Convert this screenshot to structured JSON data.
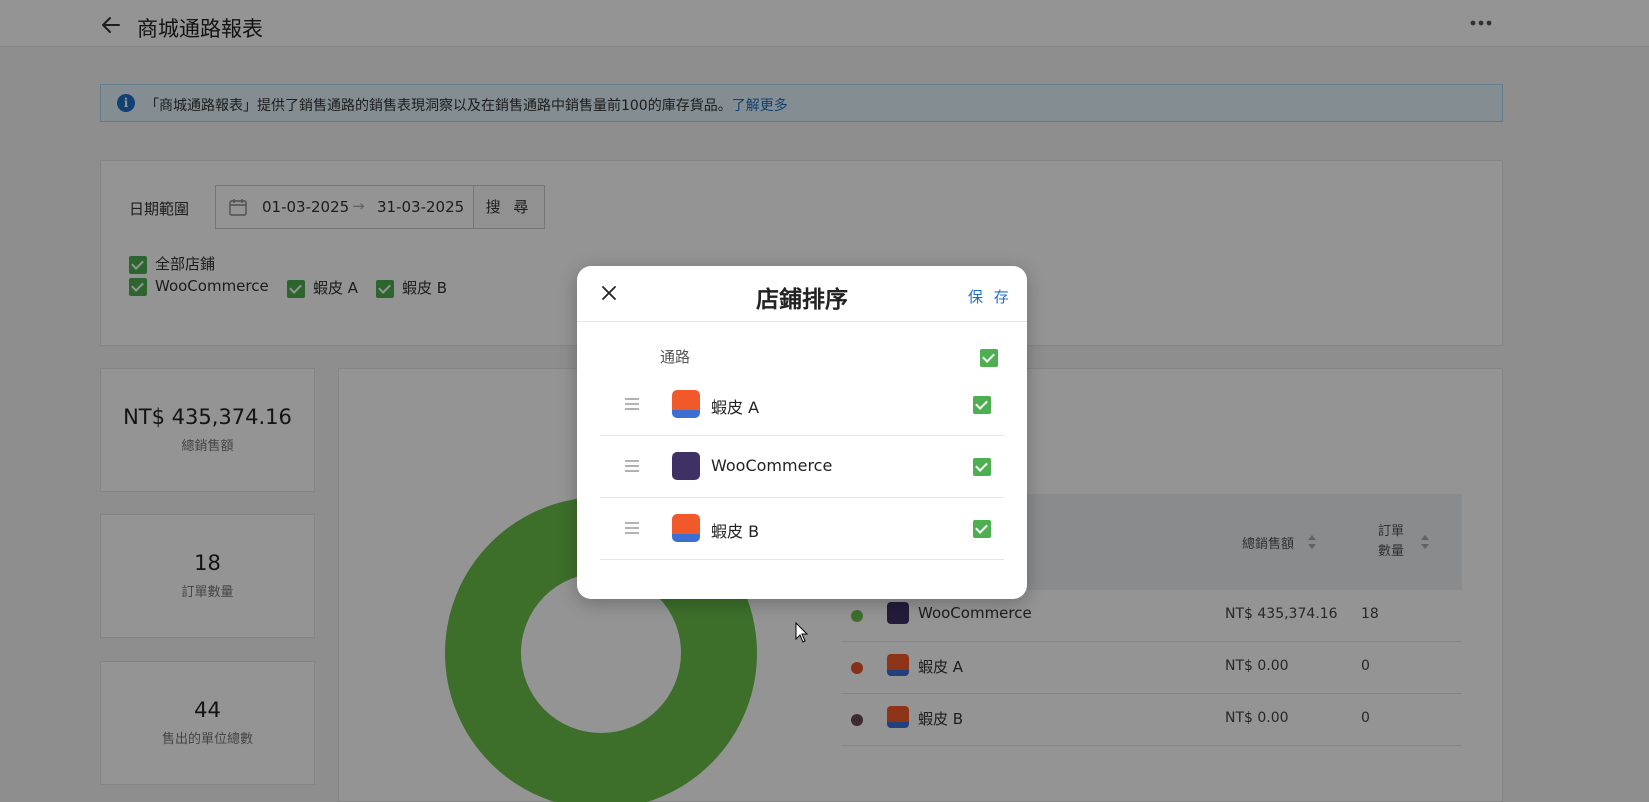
{
  "header": {
    "title": "商城通路報表"
  },
  "banner": {
    "text": "「商城通路報表」提供了銷售通路的銷售表現洞察以及在銷售通路中銷售量前100的庫存貨品。",
    "link": "了解更多"
  },
  "filter": {
    "date_label": "日期範圍",
    "date_start": "01-03-2025",
    "date_sep": "→",
    "date_end": "31-03-2025",
    "search_label": "搜 尋",
    "all_stores": "全部店鋪",
    "stores": [
      "WooCommerce",
      "蝦皮 A",
      "蝦皮 B"
    ]
  },
  "stats": [
    {
      "value": "NT$ 435,374.16",
      "label": "總銷售額"
    },
    {
      "value": "18",
      "label": "訂單數量"
    },
    {
      "value": "44",
      "label": "售出的單位總數"
    }
  ],
  "table": {
    "col_sales": "總銷售額",
    "col_orders_1": "訂單",
    "col_orders_2": "數量",
    "rows": [
      {
        "name": "WooCommerce",
        "sales": "NT$ 435,374.16",
        "orders": "18",
        "color": "#6abf4b"
      },
      {
        "name": "蝦皮 A",
        "sales": "NT$ 0.00",
        "orders": "0",
        "color": "#e8532a"
      },
      {
        "name": "蝦皮 B",
        "sales": "NT$ 0.00",
        "orders": "0",
        "color": "#6b4a52"
      }
    ]
  },
  "chart_data": {
    "type": "pie",
    "categories": [
      "WooCommerce",
      "蝦皮 A",
      "蝦皮 B"
    ],
    "values": [
      435374.16,
      0,
      0
    ],
    "colors": [
      "#6abf4b",
      "#e8532a",
      "#6b4a52"
    ]
  },
  "modal": {
    "title": "店鋪排序",
    "save_label": "保 存",
    "column_label": "通路",
    "items": [
      {
        "name": "蝦皮 A",
        "logo": "shopee"
      },
      {
        "name": "WooCommerce",
        "logo": "woo"
      },
      {
        "name": "蝦皮 B",
        "logo": "shopee"
      }
    ]
  },
  "icons": {
    "back": "arrow-left-icon",
    "more": "more-horizontal-icon",
    "info": "info-icon",
    "calendar": "calendar-icon",
    "close": "close-icon",
    "drag": "drag-handle-icon"
  }
}
